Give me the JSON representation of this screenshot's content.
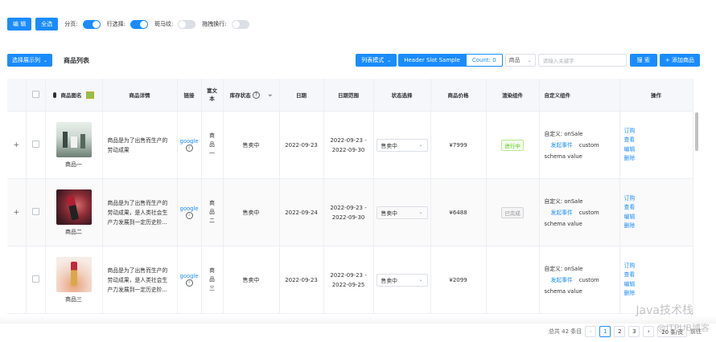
{
  "toolbar": {
    "edit_label": "编 辑",
    "select_all_label": "全选",
    "pagination_label": "分页:",
    "row_select_label": "行选择:",
    "zebra_label": "斑马纹:",
    "drag_label": "拖拽换行:",
    "switches": {
      "pagination": true,
      "row_select": true,
      "zebra": false,
      "drag": false
    }
  },
  "header": {
    "columns_button": "选择展示列",
    "title": "商品列表",
    "list_mode": "列表模式",
    "header_slot": "Header Slot Sample",
    "count_label": "Count: 0",
    "field_select": "商品",
    "search_placeholder": "请输入关键字",
    "search_label": "搜 索",
    "add_label": "+ 添加商品"
  },
  "table": {
    "columns": {
      "image": "商品图名",
      "detail": "商品详情",
      "link": "链接",
      "richtext": "富文本",
      "stock": "库存状态",
      "date": "日期",
      "daterange": "日期范围",
      "status_select": "状态选择",
      "price": "商品价格",
      "render": "渲染组件",
      "custom": "自定义组件",
      "ops": "操作"
    },
    "rows": [
      {
        "name": "商品一",
        "detail": "商品是为了出售而生产的劳动成果",
        "link": "google",
        "rich": "商品一",
        "stock": "售卖中",
        "date": "2022-09-23",
        "range_start": "2022-09-23 -",
        "range_end": "2022-09-30",
        "status": "售卖中",
        "price": "¥7999",
        "tag": "进行中",
        "custom_line1": "自定义: onSale",
        "custom_event": "发起事件",
        "custom_word": "custom",
        "custom_line3": "schema value",
        "ops": [
          "订购",
          "查看",
          "编辑",
          "删除"
        ]
      },
      {
        "name": "商品二",
        "detail": "商品是为了出售而生产的劳动成果，是人类社会生产力发展到一定历史阶...",
        "link": "google",
        "rich": "商品二",
        "stock": "售卖中",
        "date": "2022-09-24",
        "range_start": "2022-09-23 -",
        "range_end": "2022-09-30",
        "status": "售卖中",
        "price": "¥6488",
        "tag": "已完成",
        "custom_line1": "自定义: onSale",
        "custom_event": "发起事件",
        "custom_word": "custom",
        "custom_line3": "schema value",
        "ops": [
          "订购",
          "查看",
          "编辑",
          "删除"
        ]
      },
      {
        "name": "商品三",
        "detail": "商品是为了出售而生产的劳动成果，是人类社会生产力发展到一定历史阶...",
        "link": "google",
        "rich": "商品三",
        "stock": "售卖中",
        "date": "2022-09-23",
        "range_start": "2022-09-23 -",
        "range_end": "2022-09-25",
        "status": "售卖中",
        "price": "¥2099",
        "tag": "",
        "custom_line1": "自定义: onSale",
        "custom_event": "发起事件",
        "custom_word": "custom",
        "custom_line3": "schema value",
        "ops": [
          "订购",
          "查看",
          "编辑",
          "删除"
        ]
      }
    ]
  },
  "pagination": {
    "total": "总共 42 条目",
    "prev": "‹",
    "pages": [
      "1",
      "2",
      "3"
    ],
    "next": "›",
    "page_size": "20 条/页",
    "jump": "前往"
  },
  "watermark": {
    "line1": "Java技术栈",
    "line2": "@ITPUB博客"
  },
  "colors": {
    "primary": "#1a8cff",
    "border": "#ebeef5",
    "header_bg": "#f5f7fa"
  }
}
